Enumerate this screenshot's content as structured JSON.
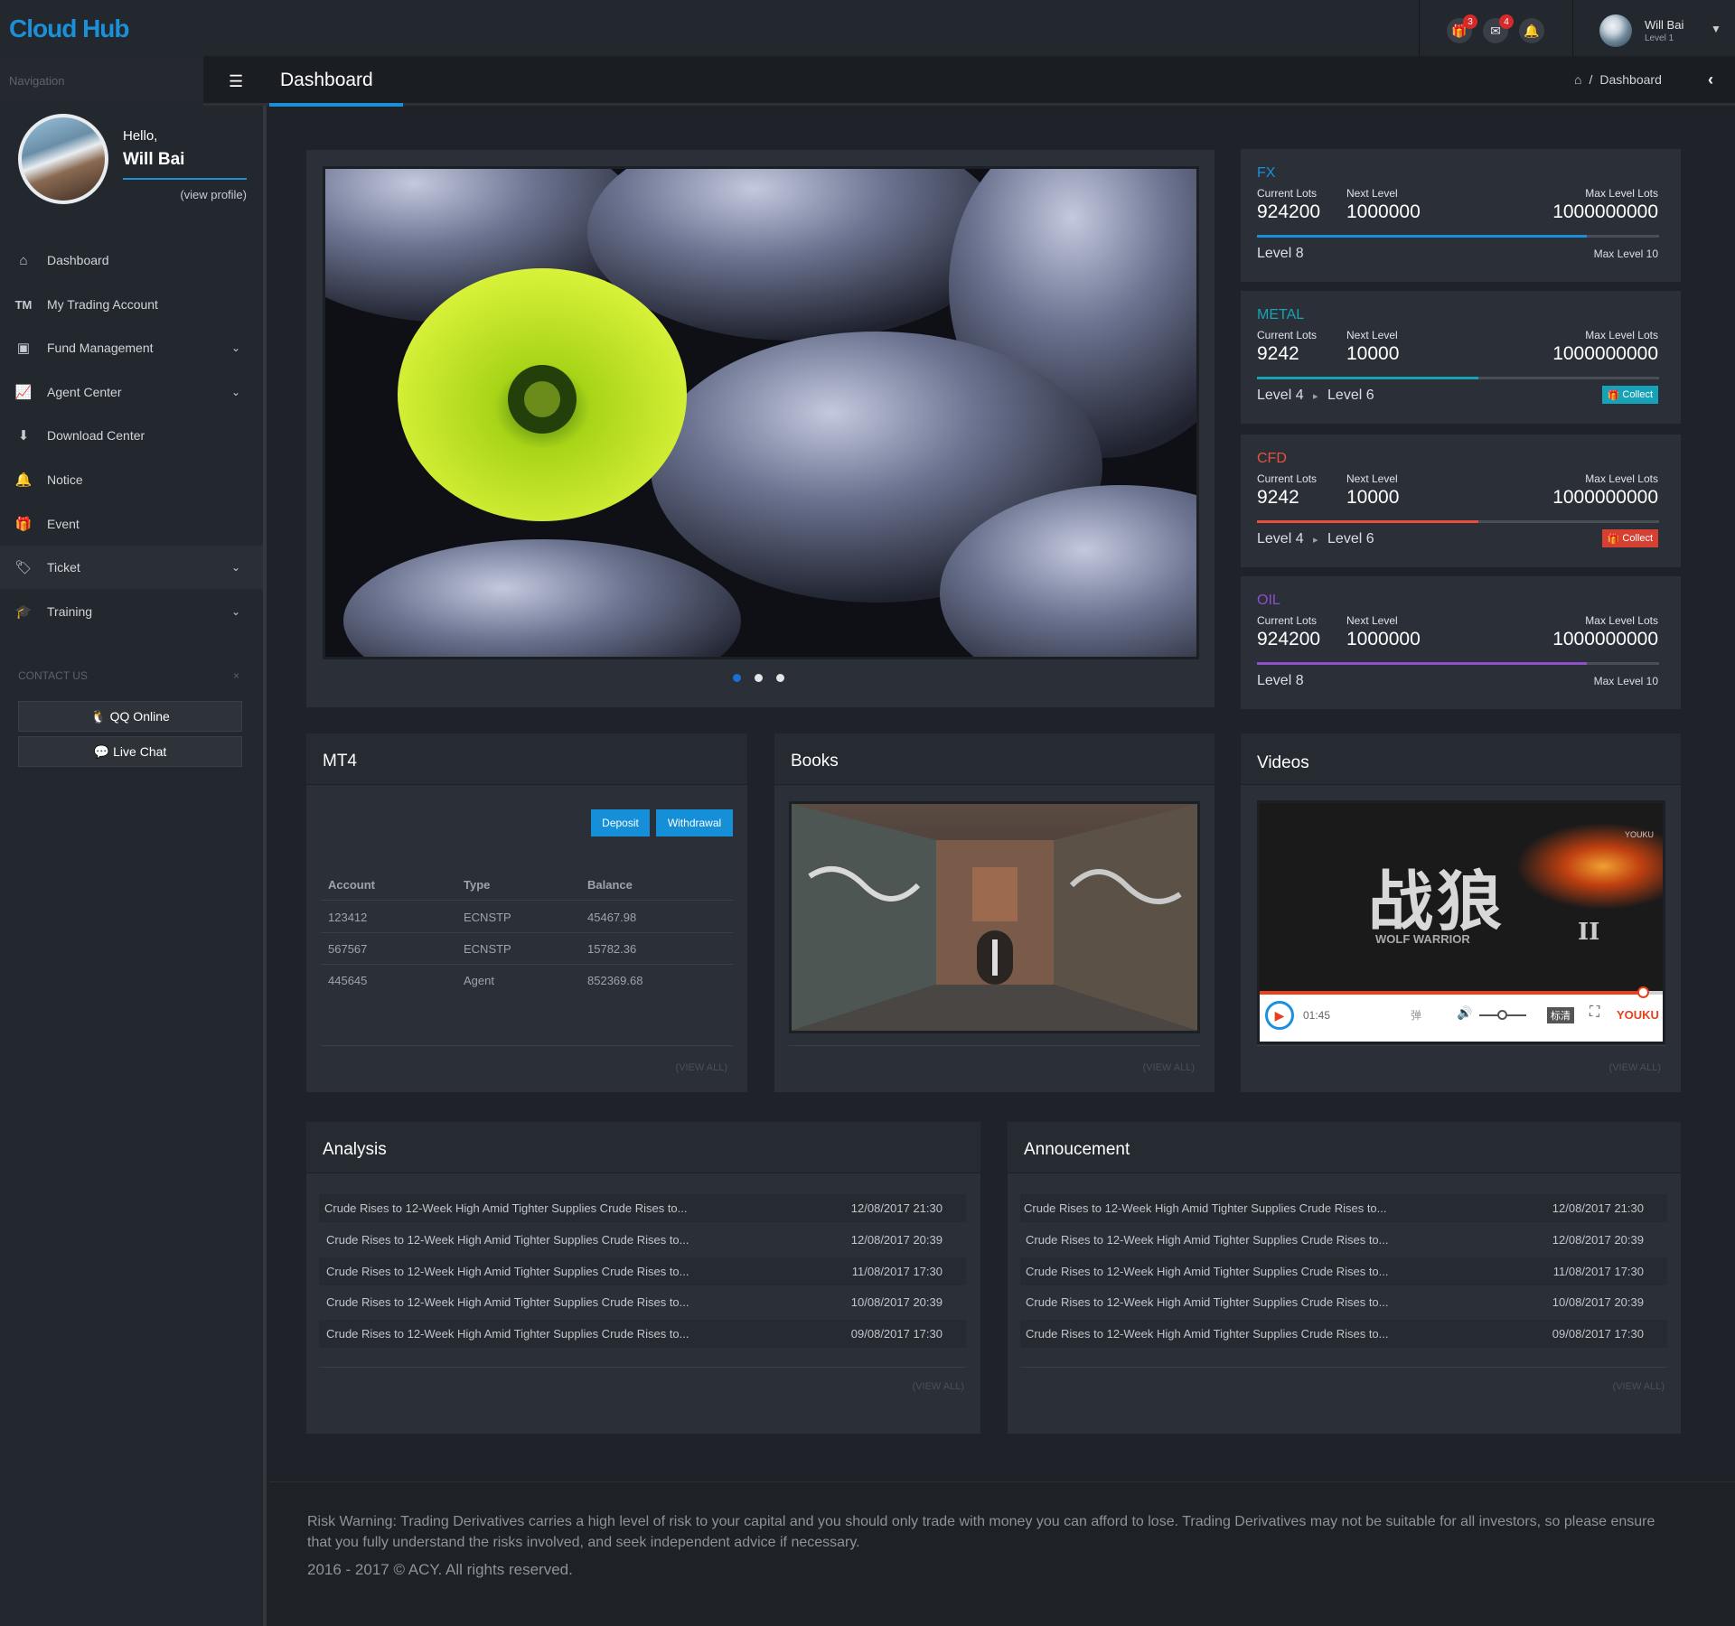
{
  "app": {
    "logo": "Cloud Hub"
  },
  "topbar": {
    "gift_badge": "3",
    "mail_badge": "4",
    "user_name": "Will Bai",
    "user_level": "Level 1"
  },
  "sidebar": {
    "nav_label": "Navigation",
    "hello": "Hello,",
    "name": "Will Bai",
    "view_profile": "(view profile)",
    "items": [
      {
        "label": "Dashboard",
        "icon": "home-icon"
      },
      {
        "label": "My Trading Account",
        "icon": "tm-icon"
      },
      {
        "label": "Fund Management",
        "icon": "money-icon"
      },
      {
        "label": "Agent Center",
        "icon": "chart-icon"
      },
      {
        "label": "Download Center",
        "icon": "download-icon"
      },
      {
        "label": "Notice",
        "icon": "bell-icon"
      },
      {
        "label": "Event",
        "icon": "gift-icon"
      },
      {
        "label": "Ticket",
        "icon": "tags-icon"
      },
      {
        "label": "Training",
        "icon": "graduation-cap-icon"
      }
    ],
    "contact_label": "CONTACT US",
    "contact_close": "×",
    "qq_online": "QQ Online",
    "live_chat": "Live Chat"
  },
  "header": {
    "title": "Dashboard",
    "breadcrumb_sep": "/",
    "breadcrumb": "Dashboard"
  },
  "levels": [
    {
      "name": "FX",
      "color": "#1b8fd8",
      "cur_label": "Current Lots",
      "cur": "924200",
      "next_label": "Next Level",
      "next": "1000000",
      "max_label": "Max Level Lots",
      "max": "1000000000",
      "progress": 0.82,
      "level": "Level 8",
      "right": "Max Level 10"
    },
    {
      "name": "METAL",
      "color": "#17a2b8",
      "cur_label": "Current Lots",
      "cur": "9242",
      "next_label": "Next Level",
      "next": "10000",
      "max_label": "Max Level Lots",
      "max": "1000000000",
      "progress": 0.55,
      "level": "Level 4",
      "arrow": "▸",
      "level_next": "Level 6",
      "collect": "Collect"
    },
    {
      "name": "CFD",
      "color": "#e8503e",
      "cur_label": "Current Lots",
      "cur": "9242",
      "next_label": "Next Level",
      "next": "10000",
      "max_label": "Max Level Lots",
      "max": "1000000000",
      "progress": 0.55,
      "level": "Level 4",
      "arrow": "▸",
      "level_next": "Level 6",
      "collect": "Collect"
    },
    {
      "name": "OIL",
      "color": "#8e4fc7",
      "cur_label": "Current Lots",
      "cur": "924200",
      "next_label": "Next Level",
      "next": "1000000",
      "max_label": "Max Level Lots",
      "max": "1000000000",
      "progress": 0.82,
      "level": "Level 8",
      "right": "Max Level 10"
    }
  ],
  "mt4": {
    "title": "MT4",
    "deposit": "Deposit",
    "withdrawal": "Withdrawal",
    "columns": [
      "Account",
      "Type",
      "Balance"
    ],
    "rows": [
      [
        "123412",
        "ECNSTP",
        "45467.98"
      ],
      [
        "567567",
        "ECNSTP",
        "15782.36"
      ],
      [
        "445645",
        "Agent",
        "852369.68"
      ]
    ],
    "view_all": "(VIEW ALL)"
  },
  "books": {
    "title": "Books",
    "view_all": "(VIEW ALL)"
  },
  "videos": {
    "title": "Videos",
    "view_all": "(VIEW ALL)",
    "time": "01:45",
    "brand": "YOUKU",
    "brand_small": "YOUKU",
    "danmu": "弹",
    "quality": "标清",
    "movie_title": "战狼",
    "movie_sub": "WOLF WARRIOR",
    "movie_num": "II",
    "progress": 0.95
  },
  "analysis": {
    "title": "Analysis",
    "view_all": "(VIEW ALL)",
    "rows": [
      {
        "text": "Crude Rises to 12-Week High Amid Tighter Supplies Crude Rises to...",
        "date": "12/08/2017 21:30"
      },
      {
        "text": "Crude Rises to 12-Week High Amid Tighter Supplies Crude Rises to...",
        "date": "12/08/2017 20:39"
      },
      {
        "text": "Crude Rises to 12-Week High Amid Tighter Supplies Crude Rises to...",
        "date": "11/08/2017 17:30"
      },
      {
        "text": "Crude Rises to 12-Week High Amid Tighter Supplies Crude Rises to...",
        "date": "10/08/2017 20:39"
      },
      {
        "text": "Crude Rises to 12-Week High Amid Tighter Supplies Crude Rises to...",
        "date": "09/08/2017 17:30"
      }
    ]
  },
  "announcement": {
    "title": "Annoucement",
    "view_all": "(VIEW ALL)",
    "rows": [
      {
        "text": "Crude Rises to 12-Week High Amid Tighter Supplies Crude Rises to...",
        "date": "12/08/2017 21:30"
      },
      {
        "text": "Crude Rises to 12-Week High Amid Tighter Supplies Crude Rises to...",
        "date": "12/08/2017 20:39"
      },
      {
        "text": "Crude Rises to 12-Week High Amid Tighter Supplies Crude Rises to...",
        "date": "11/08/2017 17:30"
      },
      {
        "text": "Crude Rises to 12-Week High Amid Tighter Supplies Crude Rises to...",
        "date": "10/08/2017 20:39"
      },
      {
        "text": "Crude Rises to 12-Week High Amid Tighter Supplies Crude Rises to...",
        "date": "09/08/2017 17:30"
      }
    ]
  },
  "footer": {
    "risk": "Risk Warning: Trading Derivatives carries a high level of risk to your capital and you should only trade with money you can afford to lose. Trading Derivatives may not be suitable for all investors, so please ensure that you fully understand the risks involved, and seek independent advice if necessary.",
    "copyright": "2016 - 2017 © ACY. All rights reserved."
  }
}
